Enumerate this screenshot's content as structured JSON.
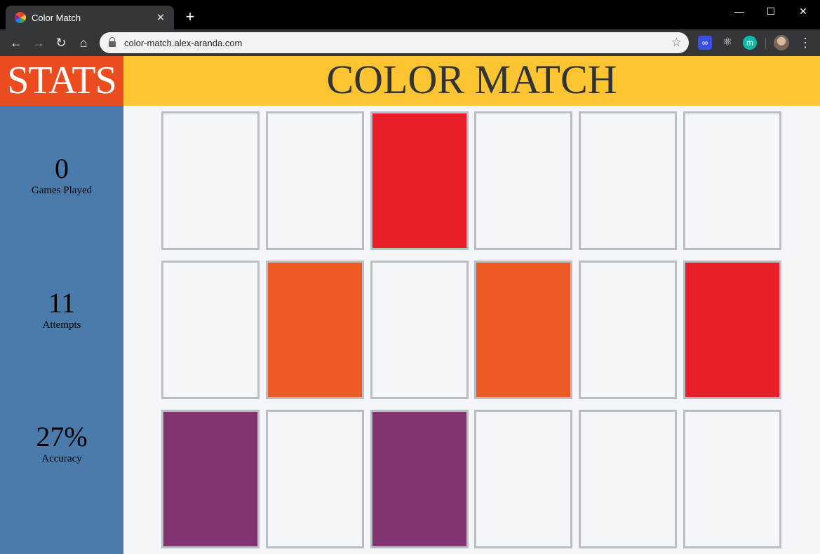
{
  "browser": {
    "tab_title": "Color Match",
    "tab_close": "✕",
    "new_tab": "+",
    "url": "color-match.alex-aranda.com",
    "window": {
      "minimize": "—",
      "maximize": "☐",
      "close": "✕"
    },
    "nav": {
      "back": "←",
      "forward": "→",
      "reload": "↻",
      "home": "⌂"
    },
    "star": "☆",
    "extensions": [
      "∞",
      "⚛",
      "m"
    ],
    "menu": "⋮"
  },
  "app": {
    "stats_title": "STATS",
    "title": "COLOR MATCH",
    "stats": [
      {
        "value": "0",
        "label": "Games Played"
      },
      {
        "value": "11",
        "label": "Attempts"
      },
      {
        "value": "27%",
        "label": "Accuracy"
      }
    ],
    "colors": {
      "stats_header": "#ea4b1f",
      "title_bar": "#fdc532",
      "sidebar": "#4a7bab",
      "card_back": "#f4f6f9",
      "card_border": "#b7bfc4"
    },
    "cards": [
      [
        {
          "state": "hidden",
          "color": ""
        },
        {
          "state": "hidden",
          "color": ""
        },
        {
          "state": "revealed",
          "color": "#e81f28"
        },
        {
          "state": "hidden",
          "color": ""
        },
        {
          "state": "hidden",
          "color": ""
        },
        {
          "state": "hidden",
          "color": ""
        }
      ],
      [
        {
          "state": "hidden",
          "color": ""
        },
        {
          "state": "revealed",
          "color": "#ee5a26"
        },
        {
          "state": "hidden",
          "color": ""
        },
        {
          "state": "revealed",
          "color": "#ee5a26"
        },
        {
          "state": "hidden",
          "color": ""
        },
        {
          "state": "revealed",
          "color": "#e81f28"
        }
      ],
      [
        {
          "state": "revealed",
          "color": "#823370"
        },
        {
          "state": "hidden",
          "color": ""
        },
        {
          "state": "revealed",
          "color": "#823370"
        },
        {
          "state": "hidden",
          "color": ""
        },
        {
          "state": "hidden",
          "color": ""
        },
        {
          "state": "hidden",
          "color": ""
        }
      ]
    ]
  }
}
